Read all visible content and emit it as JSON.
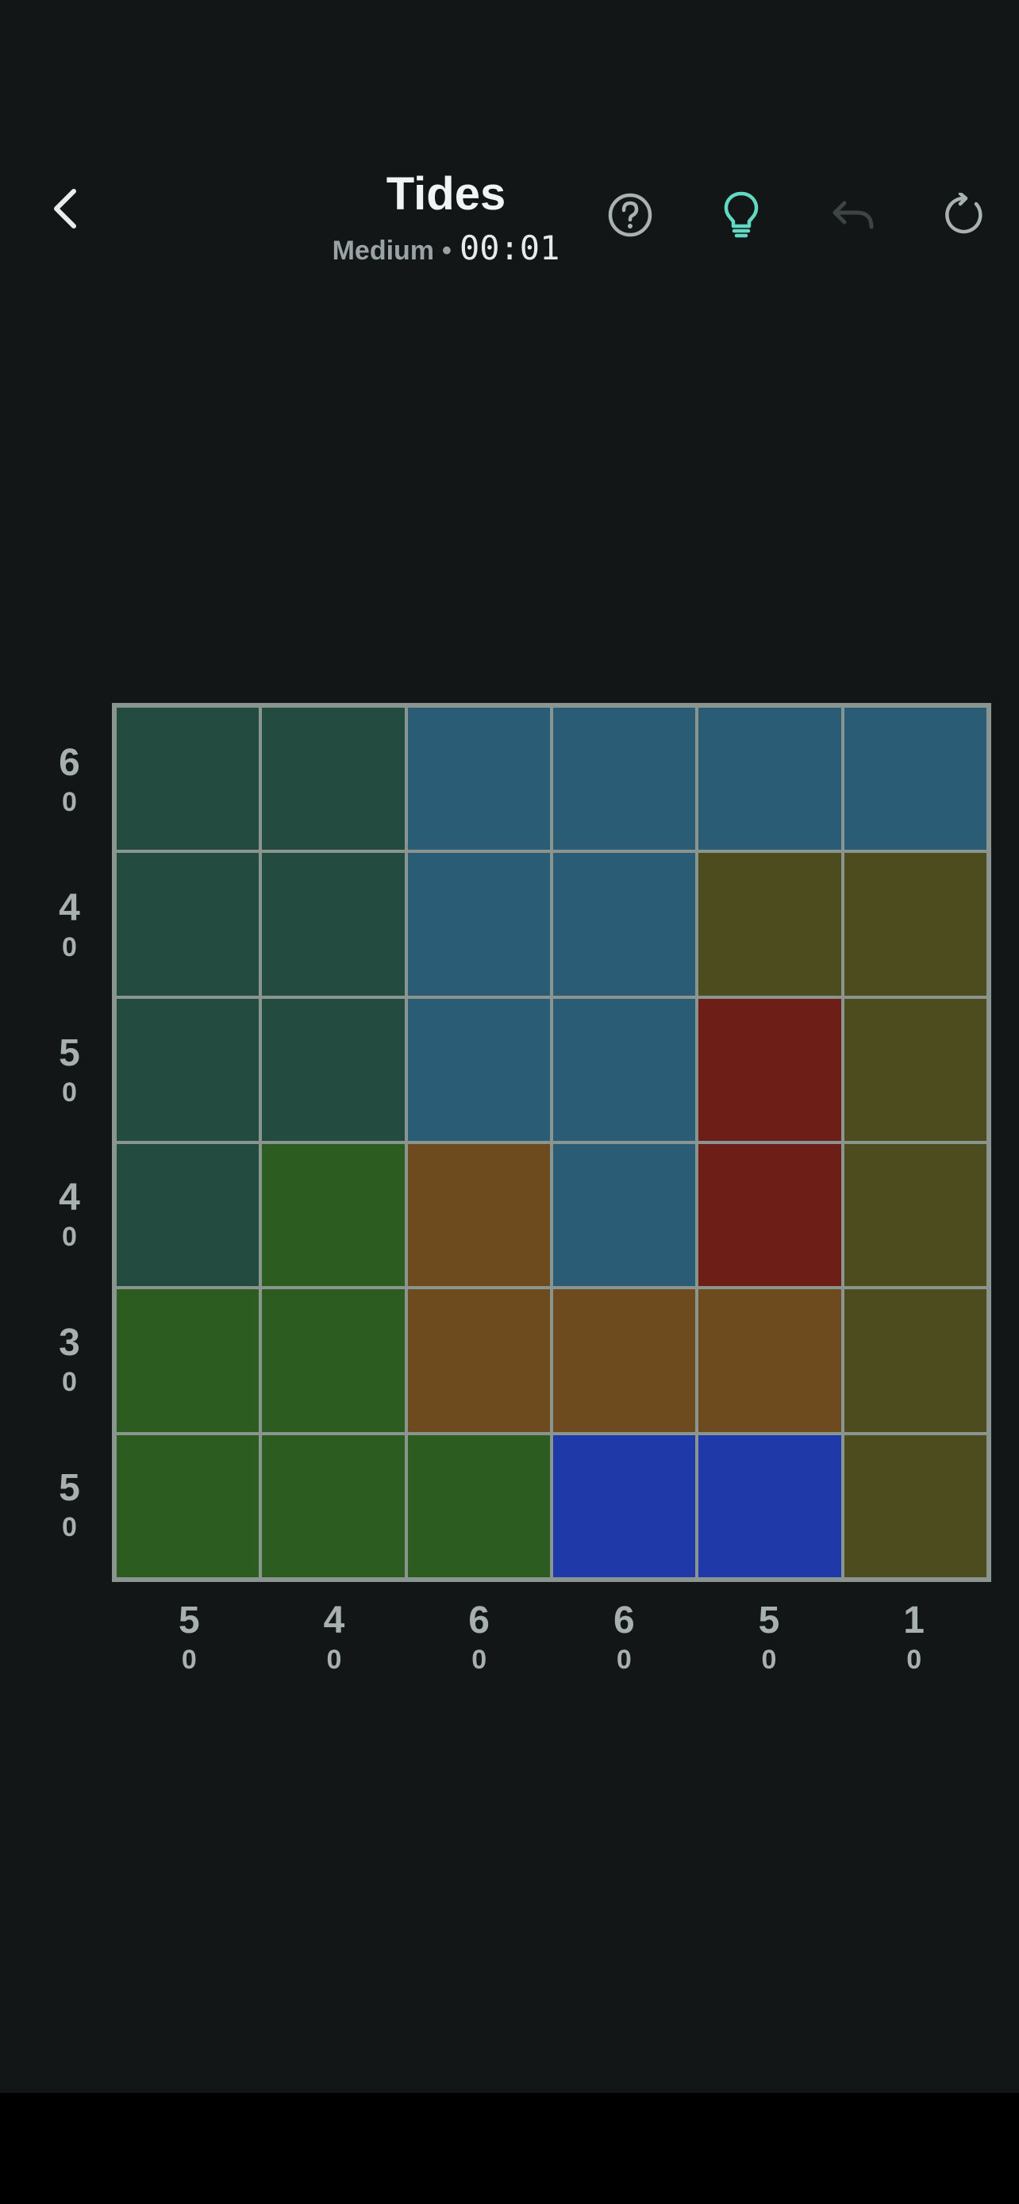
{
  "header": {
    "title": "Tides",
    "difficulty": "Medium",
    "separator": "•",
    "timer": "00:01",
    "icons": {
      "back": "chevron-left-icon",
      "help": "question-circle-icon",
      "hint": "lightbulb-icon",
      "undo": "undo-icon",
      "restart": "restart-icon"
    }
  },
  "colors": {
    "background": "#121616",
    "hint_accent": "#63d9c3",
    "undo_disabled": "#3e4444",
    "grid_line": "#8a9590"
  },
  "board": {
    "rows": 6,
    "cols": 6,
    "palette": {
      "T": "#234b40",
      "B": "#2b5c76",
      "O": "#4c4c1f",
      "R": "#6d1f17",
      "G": "#2d5c21",
      "N": "#6e4b1f",
      "L": "#1f39a8"
    },
    "grid": [
      [
        "T",
        "T",
        "B",
        "B",
        "B",
        "B"
      ],
      [
        "T",
        "T",
        "B",
        "B",
        "O",
        "O"
      ],
      [
        "T",
        "T",
        "B",
        "B",
        "R",
        "O"
      ],
      [
        "T",
        "G",
        "N",
        "B",
        "R",
        "O"
      ],
      [
        "G",
        "G",
        "N",
        "N",
        "N",
        "O"
      ],
      [
        "G",
        "G",
        "G",
        "L",
        "L",
        "O"
      ]
    ]
  },
  "row_clues": [
    {
      "main": "6",
      "sub": "0"
    },
    {
      "main": "4",
      "sub": "0"
    },
    {
      "main": "5",
      "sub": "0"
    },
    {
      "main": "4",
      "sub": "0"
    },
    {
      "main": "3",
      "sub": "0"
    },
    {
      "main": "5",
      "sub": "0"
    }
  ],
  "col_clues": [
    {
      "main": "5",
      "sub": "0"
    },
    {
      "main": "4",
      "sub": "0"
    },
    {
      "main": "6",
      "sub": "0"
    },
    {
      "main": "6",
      "sub": "0"
    },
    {
      "main": "5",
      "sub": "0"
    },
    {
      "main": "1",
      "sub": "0"
    }
  ]
}
